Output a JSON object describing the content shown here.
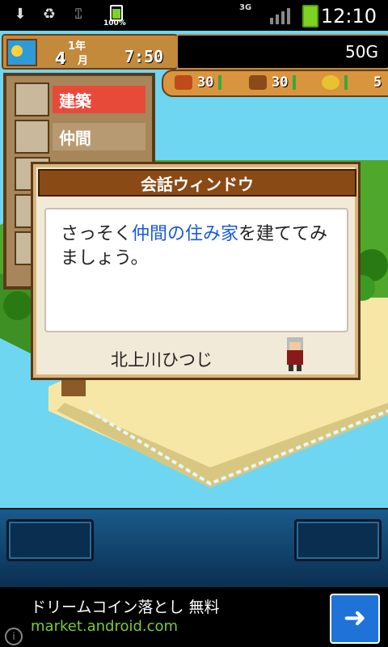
{
  "status_bar": {
    "icons": [
      "download-icon",
      "recycle-icon",
      "usb-icon"
    ],
    "battery_percent": "100%",
    "network": "3G",
    "time": "12:10"
  },
  "hud": {
    "year": "1年",
    "month": "4",
    "month_unit": "月",
    "time": "7:50",
    "gold": "50G",
    "resources": [
      {
        "name": "food-icon",
        "value": "30"
      },
      {
        "name": "wood-icon",
        "value": "30"
      },
      {
        "name": "coin-icon",
        "value": "5"
      }
    ]
  },
  "menu": {
    "items": [
      {
        "label": "建築",
        "icon": "building-icon",
        "active": true
      },
      {
        "label": "仲間",
        "icon": "friends-icon",
        "active": false
      }
    ]
  },
  "dialog": {
    "title": "会話ウィンドウ",
    "message_pre": "さっそく",
    "message_highlight": "仲間の住み家",
    "message_post": "を建ててみましょう。",
    "speaker": "北上川ひつじ"
  },
  "ad": {
    "headline": "ドリームコイン落とし 無料",
    "url": "market.android.com",
    "button_icon": "arrow-right-icon"
  }
}
